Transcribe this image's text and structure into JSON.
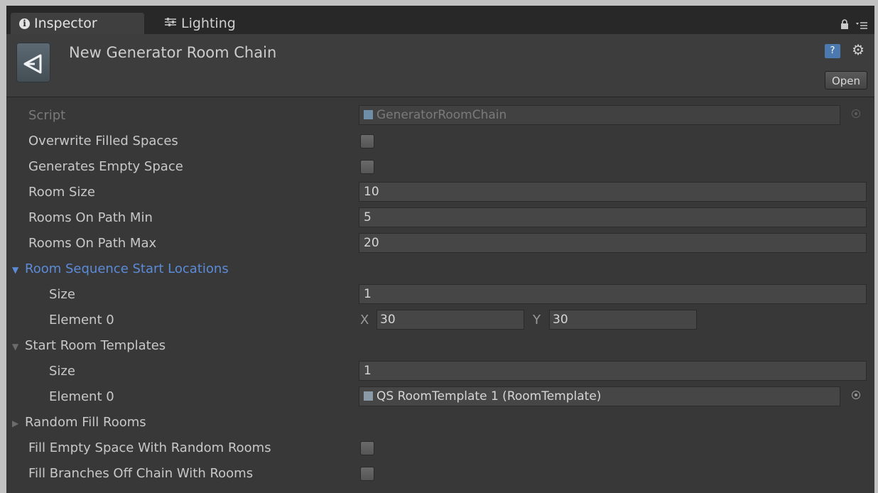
{
  "tabs": [
    {
      "label": "Inspector",
      "icon": "info-icon"
    },
    {
      "label": "Lighting",
      "icon": "lighting-icon"
    }
  ],
  "header": {
    "title": "New Generator Room Chain",
    "open_label": "Open",
    "help_glyph": "?"
  },
  "props": {
    "script_label": "Script",
    "script_value": "GeneratorRoomChain",
    "overwrite_label": "Overwrite Filled Spaces",
    "overwrite_checked": false,
    "generates_empty_label": "Generates Empty Space",
    "generates_empty_checked": false,
    "room_size_label": "Room Size",
    "room_size_value": "10",
    "rooms_min_label": "Rooms On Path Min",
    "rooms_min_value": "5",
    "rooms_max_label": "Rooms On Path Max",
    "rooms_max_value": "20",
    "start_locations": {
      "label": "Room Sequence Start Locations",
      "size_label": "Size",
      "size_value": "1",
      "element_label": "Element 0",
      "x_label": "X",
      "x_value": "30",
      "y_label": "Y",
      "y_value": "30"
    },
    "start_templates": {
      "label": "Start Room Templates",
      "size_label": "Size",
      "size_value": "1",
      "element_label": "Element 0",
      "element_value": "QS RoomTemplate 1 (RoomTemplate)"
    },
    "random_fill_label": "Random Fill Rooms",
    "fill_empty_label": "Fill Empty Space With Random Rooms",
    "fill_empty_checked": false,
    "fill_branches_label": "Fill Branches Off Chain With Rooms",
    "fill_branches_checked": false
  },
  "colors": {
    "panel_bg": "#383838",
    "foldout_active": "#5c8bd8",
    "field_bg": "#464646"
  }
}
